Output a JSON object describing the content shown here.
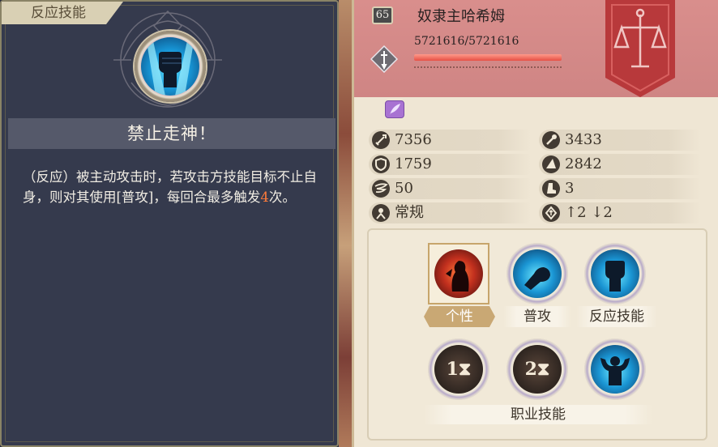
{
  "left_panel": {
    "tab_label": "反应技能",
    "skill_name": "禁止走神！",
    "description_before": "（反应）被主动攻击时，若攻击方技能目标不止自身，则对其使用[普攻]，每回合最多触发",
    "description_count": "4",
    "description_after": "次。"
  },
  "unit": {
    "level": "65",
    "name": "奴隶主哈希姆",
    "hp_text": "5721616/5721616",
    "hp_fraction": 1.0,
    "class_icon": "sword-diamond-icon",
    "banner_icon": "scales-crest-icon",
    "trait_icon": "feather-icon",
    "colors": {
      "header": "#d98e8c",
      "banner": "#b8393b",
      "hp_fill": "#e64f45",
      "highlight": "#ff7b3b"
    }
  },
  "stats": [
    {
      "icon": "sword-icon",
      "value": "7356"
    },
    {
      "icon": "wand-icon",
      "value": "3433"
    },
    {
      "icon": "shield-icon",
      "value": "1759"
    },
    {
      "icon": "wizard-hat-icon",
      "value": "2842"
    },
    {
      "icon": "wing-icon",
      "value": "50"
    },
    {
      "icon": "boot-icon",
      "value": "3"
    },
    {
      "icon": "terrain-icon",
      "value": "常规"
    },
    {
      "icon": "height-icon",
      "value": "↑2 ↓2"
    }
  ],
  "skills": {
    "trait_label": "个性",
    "attack_label": "普攻",
    "reaction_label": "反应技能",
    "class_skills_label": "职业技能",
    "class_skill_1_cd": "1",
    "class_skill_2_cd": "2"
  }
}
